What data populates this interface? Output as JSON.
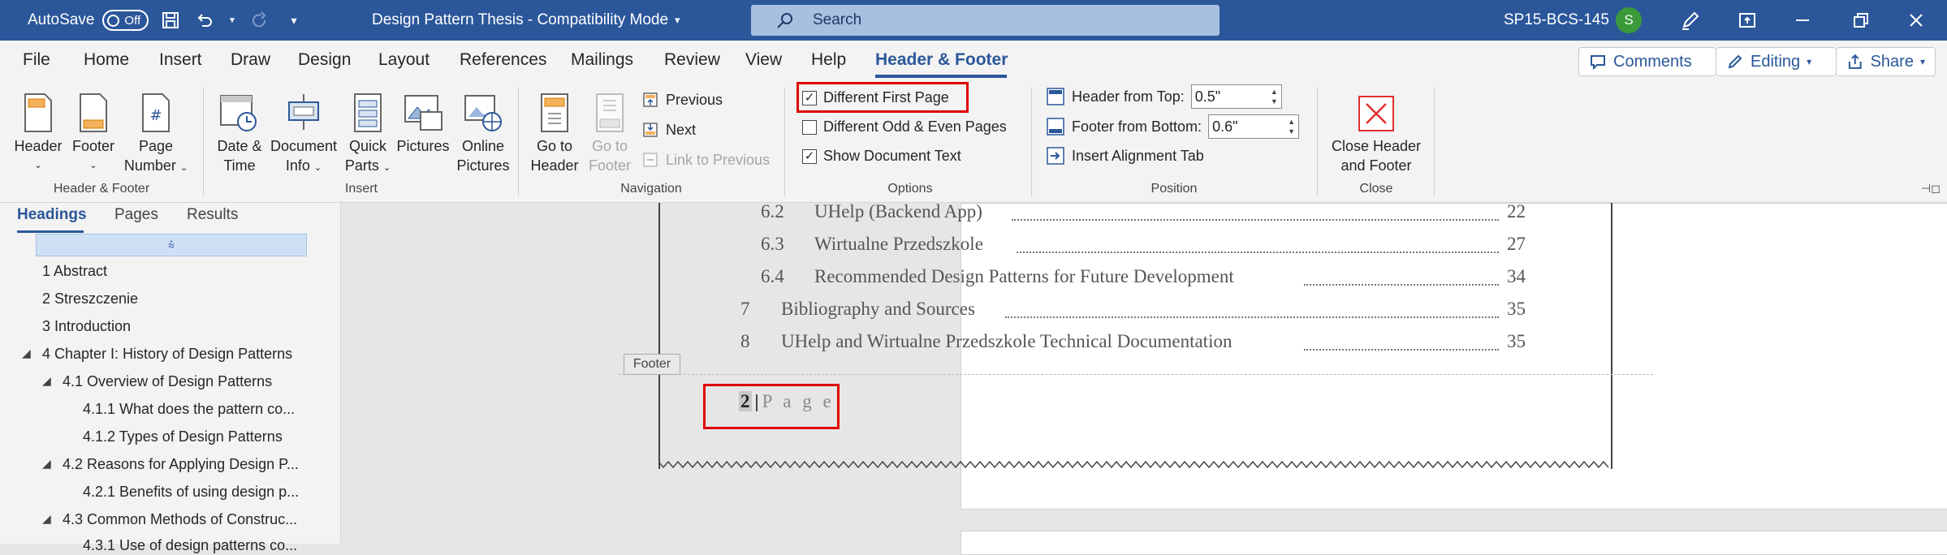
{
  "titlebar": {
    "autosave_label": "AutoSave",
    "autosave_state": "Off",
    "doc_title": "Design Pattern Thesis  -  Compatibility Mode",
    "search_placeholder": "Search",
    "user_account": "SP15-BCS-145",
    "avatar_initial": "S",
    "accent_color": "#2b579a"
  },
  "menu": {
    "tabs": [
      "File",
      "Home",
      "Insert",
      "Draw",
      "Design",
      "Layout",
      "References",
      "Mailings",
      "Review",
      "View",
      "Help",
      "Header & Footer"
    ],
    "active_tab": "Header & Footer",
    "comments_label": "Comments",
    "editing_label": "Editing",
    "share_label": "Share"
  },
  "ribbon": {
    "header_footer_group": {
      "label": "Header & Footer",
      "header_label": "Header",
      "footer_label": "Footer",
      "page_number_label_1": "Page",
      "page_number_label_2": "Number"
    },
    "insert_group": {
      "label": "Insert",
      "date_time_1": "Date &",
      "date_time_2": "Time",
      "doc_info_1": "Document",
      "doc_info_2": "Info",
      "quick_parts_1": "Quick",
      "quick_parts_2": "Parts",
      "pictures": "Pictures",
      "online_pictures_1": "Online",
      "online_pictures_2": "Pictures"
    },
    "navigation_group": {
      "label": "Navigation",
      "go_to_header_1": "Go to",
      "go_to_header_2": "Header",
      "go_to_footer_1": "Go to",
      "go_to_footer_2": "Footer",
      "previous": "Previous",
      "next": "Next",
      "link_to_previous": "Link to Previous"
    },
    "options_group": {
      "label": "Options",
      "different_first_page": "Different First Page",
      "different_first_page_checked": true,
      "different_odd_even": "Different Odd & Even Pages",
      "different_odd_even_checked": false,
      "show_document_text": "Show Document Text",
      "show_document_text_checked": true
    },
    "position_group": {
      "label": "Position",
      "header_from_top_label": "Header from Top:",
      "header_from_top_value": "0.5\"",
      "footer_from_bottom_label": "Footer from Bottom:",
      "footer_from_bottom_value": "0.6\"",
      "insert_alignment_tab": "Insert Alignment Tab"
    },
    "close_group": {
      "label": "Close",
      "close_1": "Close Header",
      "close_2": "and Footer"
    }
  },
  "navpane": {
    "tabs": [
      "Headings",
      "Pages",
      "Results"
    ],
    "active_tab": "Headings",
    "items": [
      "1 Abstract",
      "2 Streszczenie",
      "3 Introduction",
      "4 Chapter I: History of Design Patterns",
      "4.1 Overview of Design Patterns",
      "4.1.1 What does the pattern co...",
      "4.1.2 Types of Design Patterns",
      "4.2 Reasons for Applying Design P...",
      "4.2.1 Benefits of using design p...",
      "4.3 Common Methods of Construc...",
      "4.3.1 Use of design patterns co..."
    ]
  },
  "document": {
    "toc": [
      {
        "num": "6.2",
        "title": "UHelp (Backend App)",
        "page": "22"
      },
      {
        "num": "6.3",
        "title": "Wirtualne Przedszkole",
        "page": "27"
      },
      {
        "num": "6.4",
        "title": "Recommended Design Patterns for Future Development",
        "page": "34"
      },
      {
        "num": "7",
        "title": "Bibliography and Sources",
        "page": "35"
      },
      {
        "num": "8",
        "title": "UHelp and Wirtualne Przedszkole Technical Documentation",
        "page": "35"
      }
    ],
    "footer_tag": "Footer",
    "footer_page_number": "2",
    "footer_separator": "|",
    "footer_page_word": "P a g e",
    "highlight_color": "#e00000"
  }
}
